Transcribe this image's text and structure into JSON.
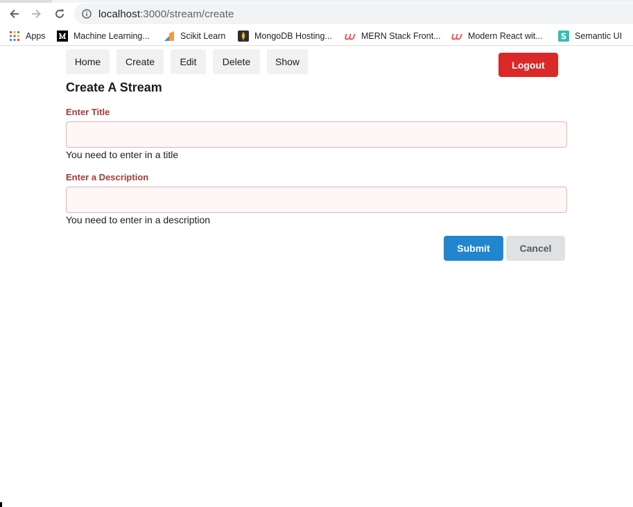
{
  "browser": {
    "url_host": "localhost",
    "url_path": ":3000/stream/create",
    "bookmarks": [
      {
        "label": "Apps",
        "icon": "apps-grid-icon"
      },
      {
        "label": "Machine Learning...",
        "icon": "medium-logo-icon"
      },
      {
        "label": "Scikit Learn",
        "icon": "scikit-learn-icon"
      },
      {
        "label": "MongoDB Hosting...",
        "icon": "mongodb-icon"
      },
      {
        "label": "MERN Stack Front...",
        "icon": "udemy-icon"
      },
      {
        "label": "Modern React wit...",
        "icon": "udemy-icon"
      },
      {
        "label": "Semantic UI",
        "icon": "semantic-ui-icon"
      }
    ]
  },
  "nav": {
    "items": [
      "Home",
      "Create",
      "Edit",
      "Delete",
      "Show"
    ],
    "logout_label": "Logout"
  },
  "form": {
    "title": "Create A Stream",
    "title_field": {
      "label": "Enter Title",
      "value": "",
      "error": "You need to enter in a title"
    },
    "description_field": {
      "label": "Enter a Description",
      "value": "",
      "error": "You need to enter in a description"
    },
    "submit_label": "Submit",
    "cancel_label": "Cancel"
  },
  "colors": {
    "logout": "#db2828",
    "submit": "#2185d0",
    "cancel": "#e0e1e2",
    "error_label": "#9f3a38",
    "error_input_bg": "#fff6f6",
    "error_input_border": "#e0b4b4"
  }
}
